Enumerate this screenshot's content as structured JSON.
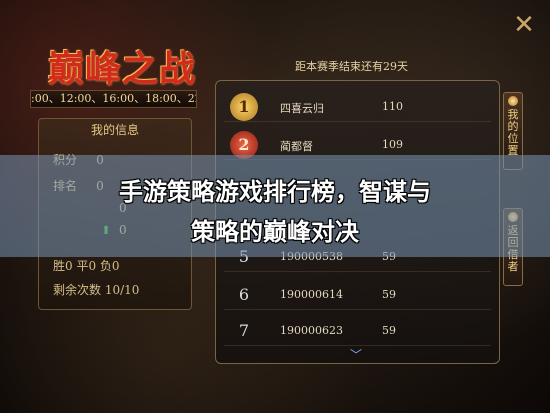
{
  "game": {
    "title": "巅峰之战",
    "times": ":00、12:00、16:00、18:00、22:0"
  },
  "info": {
    "title": "我的信息",
    "rows": [
      {
        "label": "积分",
        "value": "0"
      },
      {
        "label": "排名",
        "value": "0"
      },
      {
        "label": "",
        "value": "0"
      },
      {
        "label": "",
        "value": "0"
      }
    ],
    "record": "胜0  平0  负0",
    "remaining": "剩余次数  10/10"
  },
  "season": {
    "note": "距本赛季结束还有29天"
  },
  "ranking": [
    {
      "rank": "1",
      "name": "四喜云归",
      "score": "110"
    },
    {
      "rank": "2",
      "name": "蔺都督",
      "score": "109"
    },
    {
      "rank": "5",
      "name": "190000538",
      "score": "59"
    },
    {
      "rank": "6",
      "name": "190000614",
      "score": "59"
    },
    {
      "rank": "7",
      "name": "190000623",
      "score": "59"
    }
  ],
  "side": {
    "my_rank": "我的位置",
    "back": "返回借者"
  },
  "headline": {
    "line1": "手游策略游戏排行榜，智谋与",
    "line2": "策略的巅峰对决"
  },
  "icons": {
    "close": "close-icon",
    "chevron": "chevron-down-icon"
  },
  "colors": {
    "accent": "#d22a1d",
    "gold": "#e6c786"
  }
}
